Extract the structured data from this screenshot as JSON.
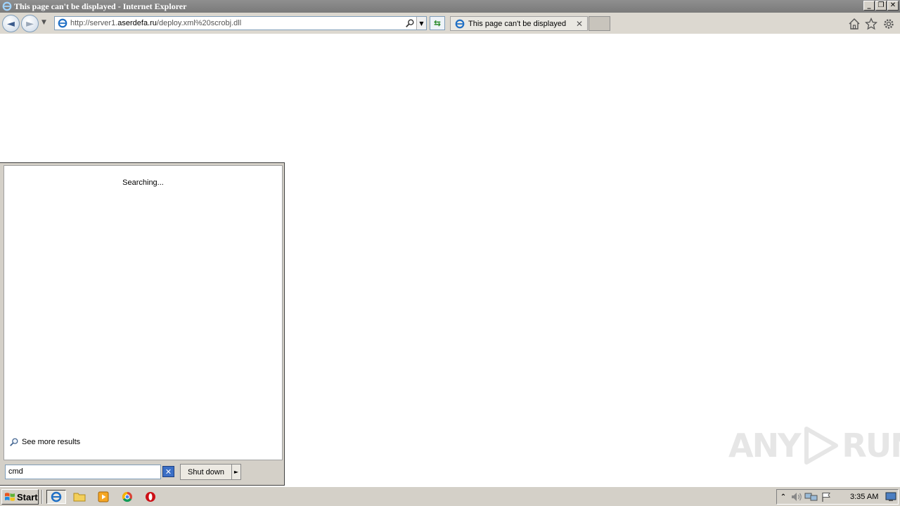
{
  "window": {
    "title": "This page can't be displayed - Internet Explorer",
    "min_glyph": "_",
    "restore_glyph": "❐",
    "close_glyph": "✕"
  },
  "navbar": {
    "back_glyph": "◄",
    "forward_glyph": "►",
    "recent_glyph": "▼",
    "url_prefix": "http://server1.",
    "url_domain": "aserdefa.ru",
    "url_suffix": "/deploy.xml%20scrobj.dll",
    "dropdown_glyph": "▼",
    "refresh_glyph": "⇆"
  },
  "tabs": [
    {
      "label": "This page can't be displayed",
      "close_glyph": "✕"
    }
  ],
  "start_menu": {
    "status_text": "Searching...",
    "see_more_label": "See more results",
    "search_value": "cmd",
    "clear_glyph": "✕",
    "shutdown_label": "Shut down",
    "shutdown_arrow": "►"
  },
  "watermark": {
    "left_text": "ANY",
    "right_text": "RUN"
  },
  "taskbar": {
    "start_label": "Start",
    "tray_expand_glyph": "⌃",
    "clock": "3:35 AM"
  },
  "colors": {
    "ie_blue": "#1f6fc5",
    "titlebar": "#7a7a7a",
    "taskbar": "#d4d0c8",
    "watermark": "#e6e6e6"
  },
  "icons": [
    "ie-icon",
    "search-icon",
    "home-icon",
    "star-icon",
    "gear-icon",
    "windows-flag-icon",
    "folder-icon",
    "media-player-icon",
    "chrome-icon",
    "opera-icon",
    "speaker-icon",
    "network-icon",
    "action-center-flag-icon",
    "show-desktop-icon"
  ]
}
